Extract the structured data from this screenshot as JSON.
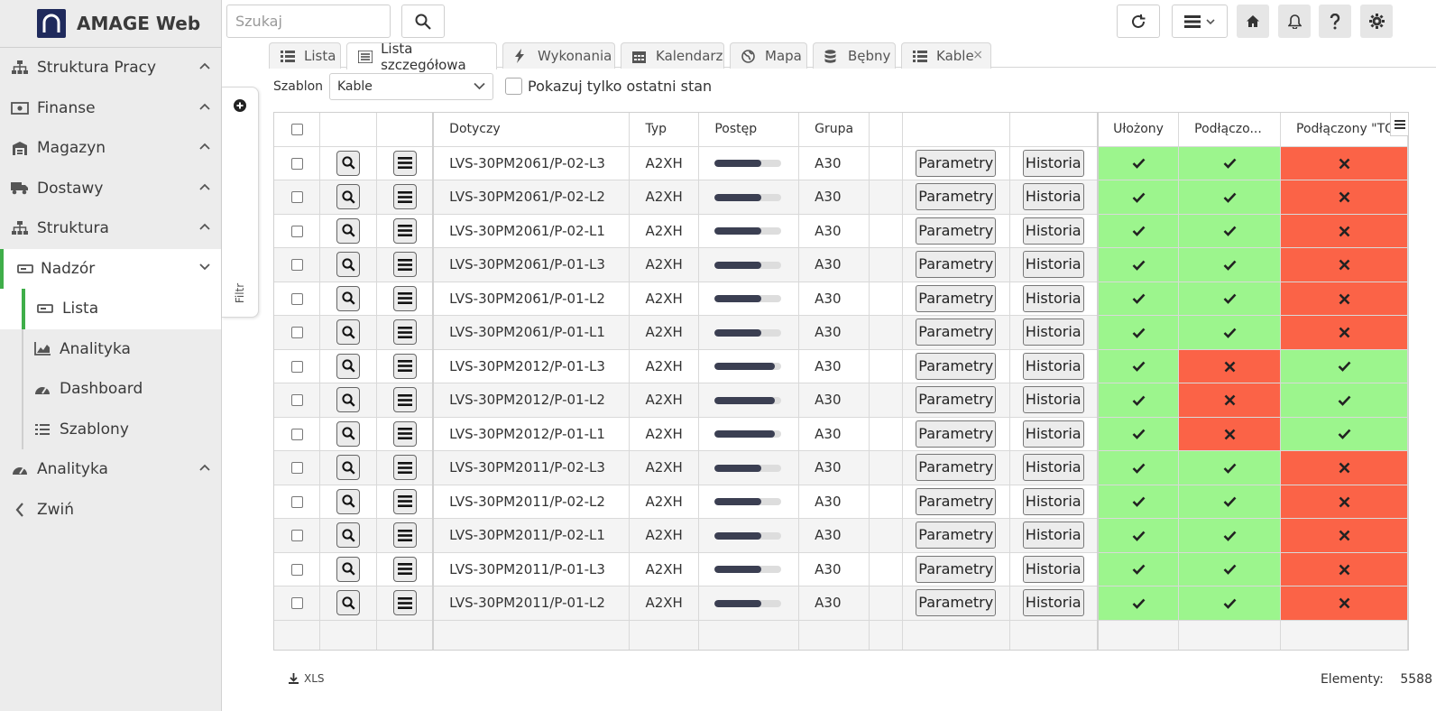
{
  "app": {
    "title": "AMAGE Web"
  },
  "sidebar": {
    "items": [
      {
        "label": "Struktura Pracy",
        "icon": "sitemap-icon",
        "expanded": false
      },
      {
        "label": "Finanse",
        "icon": "money-icon",
        "expanded": false
      },
      {
        "label": "Magazyn",
        "icon": "warehouse-icon",
        "expanded": false
      },
      {
        "label": "Dostawy",
        "icon": "truck-icon",
        "expanded": false
      },
      {
        "label": "Struktura",
        "icon": "sitemap-icon",
        "expanded": false
      },
      {
        "label": "Nadzór",
        "icon": "eye-monitor-icon",
        "expanded": true
      }
    ],
    "sub_items": [
      {
        "label": "Lista",
        "icon": "list-icon",
        "current": true
      },
      {
        "label": "Analityka",
        "icon": "chart-area-icon"
      },
      {
        "label": "Dashboard",
        "icon": "gauge-icon"
      },
      {
        "label": "Szablony",
        "icon": "list-ul-icon"
      }
    ],
    "bottom": [
      {
        "label": "Analityka",
        "icon": "gauge-icon"
      },
      {
        "label": "Zwiń",
        "icon": "chevron-left-icon"
      }
    ]
  },
  "topbar": {
    "search_placeholder": "Szukaj"
  },
  "filter": {
    "label": "Filtr"
  },
  "tabs": [
    {
      "label": "Lista",
      "icon": "list-icon"
    },
    {
      "label": "Lista szczegółowa",
      "icon": "list-detail-icon",
      "active": true
    },
    {
      "label": "Wykonania",
      "icon": "bolt-icon"
    },
    {
      "label": "Kalendarz",
      "icon": "calendar-icon"
    },
    {
      "label": "Mapa",
      "icon": "globe-icon"
    },
    {
      "label": "Bębny",
      "icon": "database-icon"
    },
    {
      "label": "Kable",
      "icon": "list-icon",
      "closable": true
    }
  ],
  "controls": {
    "template_label": "Szablon",
    "template_value": "Kable",
    "last_state_label": "Pokazuj tylko ostatni stan"
  },
  "table": {
    "headers": {
      "dotyczy": "Dotyczy",
      "typ": "Typ",
      "postep": "Postęp",
      "grupa": "Grupa",
      "ulozony": "Ułożony",
      "podlaczony1": "Podłączo...",
      "podlaczony2": "Podłączony \"TO"
    },
    "param_label": "Parametry",
    "history_label": "Historia",
    "rows": [
      {
        "dotyczy": "LVS-30PM2061/P-02-L3",
        "typ": "A2XH",
        "progress": 0.7,
        "grupa": "A30",
        "ulozony": true,
        "podl1": true,
        "podl2": false
      },
      {
        "dotyczy": "LVS-30PM2061/P-02-L2",
        "typ": "A2XH",
        "progress": 0.7,
        "grupa": "A30",
        "ulozony": true,
        "podl1": true,
        "podl2": false
      },
      {
        "dotyczy": "LVS-30PM2061/P-02-L1",
        "typ": "A2XH",
        "progress": 0.7,
        "grupa": "A30",
        "ulozony": true,
        "podl1": true,
        "podl2": false
      },
      {
        "dotyczy": "LVS-30PM2061/P-01-L3",
        "typ": "A2XH",
        "progress": 0.7,
        "grupa": "A30",
        "ulozony": true,
        "podl1": true,
        "podl2": false
      },
      {
        "dotyczy": "LVS-30PM2061/P-01-L2",
        "typ": "A2XH",
        "progress": 0.7,
        "grupa": "A30",
        "ulozony": true,
        "podl1": true,
        "podl2": false
      },
      {
        "dotyczy": "LVS-30PM2061/P-01-L1",
        "typ": "A2XH",
        "progress": 0.7,
        "grupa": "A30",
        "ulozony": true,
        "podl1": true,
        "podl2": false
      },
      {
        "dotyczy": "LVS-30PM2012/P-01-L3",
        "typ": "A2XH",
        "progress": 0.9,
        "grupa": "A30",
        "ulozony": true,
        "podl1": false,
        "podl2": true
      },
      {
        "dotyczy": "LVS-30PM2012/P-01-L2",
        "typ": "A2XH",
        "progress": 0.9,
        "grupa": "A30",
        "ulozony": true,
        "podl1": false,
        "podl2": true
      },
      {
        "dotyczy": "LVS-30PM2012/P-01-L1",
        "typ": "A2XH",
        "progress": 0.9,
        "grupa": "A30",
        "ulozony": true,
        "podl1": false,
        "podl2": true
      },
      {
        "dotyczy": "LVS-30PM2011/P-02-L3",
        "typ": "A2XH",
        "progress": 0.7,
        "grupa": "A30",
        "ulozony": true,
        "podl1": true,
        "podl2": false
      },
      {
        "dotyczy": "LVS-30PM2011/P-02-L2",
        "typ": "A2XH",
        "progress": 0.7,
        "grupa": "A30",
        "ulozony": true,
        "podl1": true,
        "podl2": false
      },
      {
        "dotyczy": "LVS-30PM2011/P-02-L1",
        "typ": "A2XH",
        "progress": 0.7,
        "grupa": "A30",
        "ulozony": true,
        "podl1": true,
        "podl2": false
      },
      {
        "dotyczy": "LVS-30PM2011/P-01-L3",
        "typ": "A2XH",
        "progress": 0.7,
        "grupa": "A30",
        "ulozony": true,
        "podl1": true,
        "podl2": false
      },
      {
        "dotyczy": "LVS-30PM2011/P-01-L2",
        "typ": "A2XH",
        "progress": 0.7,
        "grupa": "A30",
        "ulozony": true,
        "podl1": true,
        "podl2": false
      }
    ]
  },
  "footer": {
    "export_label": "XLS",
    "count_label": "Elementy:",
    "count_value": "5588"
  },
  "colors": {
    "accent": "#3fae49",
    "ok": "#9cf58d",
    "bad": "#fb6347",
    "brand": "#1f2a5c"
  }
}
